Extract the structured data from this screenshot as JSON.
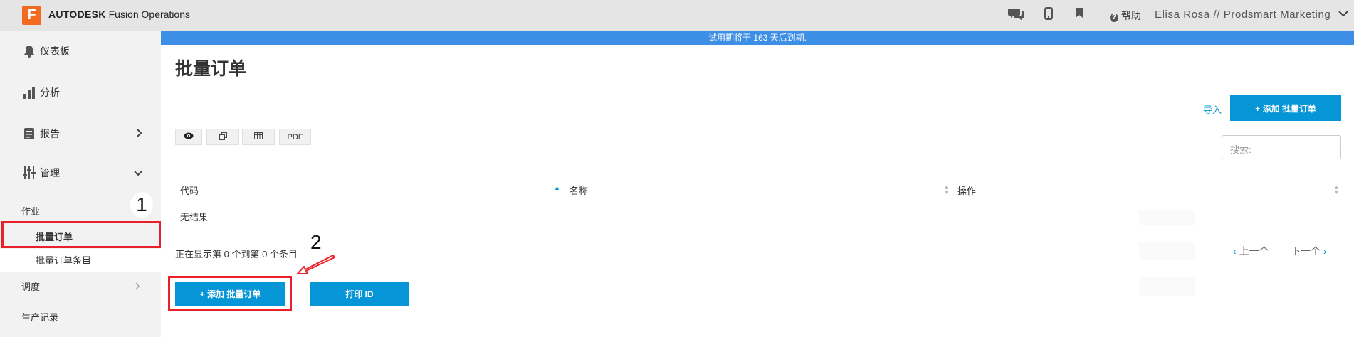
{
  "header": {
    "logo_letter": "F",
    "brand": "AUTODESK",
    "product": "Fusion Operations",
    "help_label": "帮助",
    "user_label": "Elisa Rosa // Prodsmart Marketing",
    "icons": [
      "chat-icon",
      "mobile-icon",
      "bookmark-icon",
      "help-icon",
      "chevron-down-icon"
    ]
  },
  "sidebar": {
    "dashboard": "仪表板",
    "analytics": "分析",
    "reports": "报告",
    "manage": "管理",
    "jobs_section": "作业",
    "batch_orders": "批量订单",
    "batch_order_items": "批量订单条目",
    "scheduling": "调度",
    "production_records": "生产记录"
  },
  "trial": {
    "message": "试用期将于 163 天后到期."
  },
  "main": {
    "title": "批量订单",
    "import_label": "导入",
    "add_button": "+ 添加 批量订单",
    "toolbar": {
      "pdf_label": "PDF"
    },
    "search_placeholder": "搜索:",
    "table": {
      "headers": [
        "代码",
        "名称",
        "操作"
      ],
      "empty_text": "无结果"
    },
    "info_text": "正在显示第 0 个到第 0 个条目",
    "pager": {
      "prev": "上一个",
      "next": "下一个"
    },
    "print_button": "打印 ID"
  },
  "annotations": {
    "step1": "1",
    "step2": "2"
  },
  "colors": {
    "accent": "#0696d7",
    "brand": "#f26b21",
    "highlight": "#e8202a",
    "trial_bar": "#3d8ee5"
  }
}
